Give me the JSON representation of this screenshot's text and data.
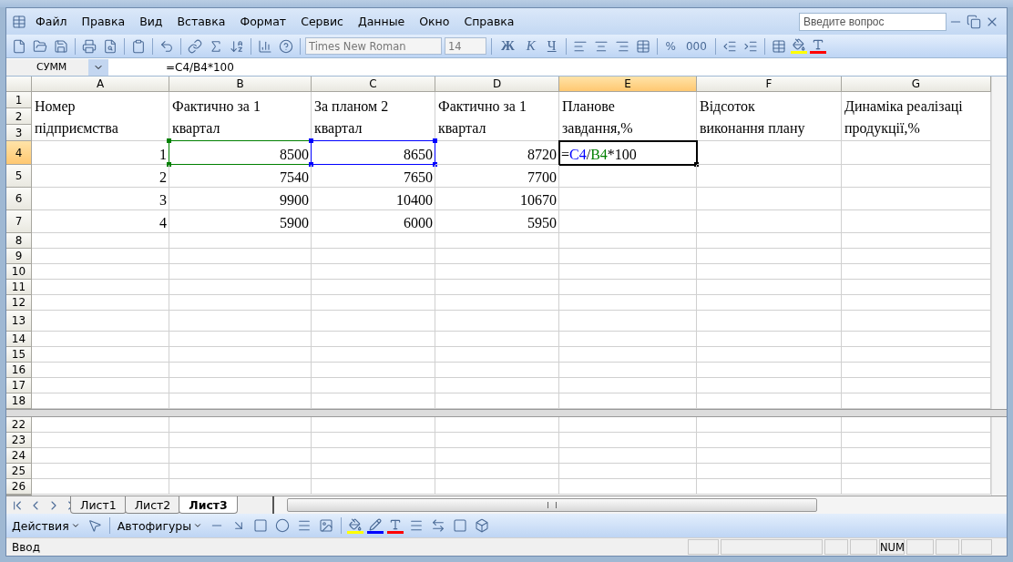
{
  "menu": [
    "Файл",
    "Правка",
    "Вид",
    "Вставка",
    "Формат",
    "Сервис",
    "Данные",
    "Окно",
    "Справка"
  ],
  "help": {
    "placeholder": "Введите вопрос"
  },
  "toolbar": {
    "font": "Times New Roman",
    "size": "14",
    "styles": [
      "Ж",
      "К",
      "Ч"
    ],
    "number_formats": [
      "%",
      "000"
    ]
  },
  "formula_bar": {
    "name_box": "СУММ",
    "formula": "=C4/B4*100"
  },
  "sheet": {
    "columns": [
      {
        "label": "A",
        "selected": false
      },
      {
        "label": "B",
        "selected": false
      },
      {
        "label": "C",
        "selected": false
      },
      {
        "label": "D",
        "selected": false
      },
      {
        "label": "E",
        "selected": true
      },
      {
        "label": "F",
        "selected": false
      },
      {
        "label": "G",
        "selected": false
      }
    ],
    "header_rows": [
      "1",
      "2",
      "3"
    ],
    "header_cells": [
      "Номер\nпідприємства",
      "Фактично за 1\nквартал",
      "За планом 2\nквартал",
      "Фактично за 1\nквартал",
      "Планове\nзавдання,%",
      "Відсоток\nвиконання плану",
      "Динаміка реалізаці\nпродукції,%"
    ],
    "rows": [
      {
        "number": "4",
        "selected": true,
        "cells": [
          {
            "text": "1"
          },
          {
            "text": "8500",
            "color": "#008000"
          },
          {
            "text": "8650",
            "color": "#0000ff"
          },
          {
            "text": "8720"
          },
          {
            "active": true,
            "parts": [
              {
                "text": "="
              },
              {
                "text": "C4",
                "color": "#0000ff"
              },
              {
                "text": "/"
              },
              {
                "text": "B4",
                "color": "#008000"
              },
              {
                "text": "*100"
              }
            ]
          }
        ]
      },
      {
        "number": "5",
        "selected": false,
        "cells": [
          {
            "text": "2"
          },
          {
            "text": "7540"
          },
          {
            "text": "7650"
          },
          {
            "text": "7700"
          }
        ]
      },
      {
        "number": "6",
        "selected": false,
        "cells": [
          {
            "text": "3"
          },
          {
            "text": "9900"
          },
          {
            "text": "10400"
          },
          {
            "text": "10670"
          }
        ]
      },
      {
        "number": "7",
        "selected": false,
        "cells": [
          {
            "text": "4"
          },
          {
            "text": "5900"
          },
          {
            "text": "6000"
          },
          {
            "text": "5950"
          }
        ]
      }
    ],
    "empty_rows": [
      "8",
      "9",
      "10",
      "11",
      "12",
      "13",
      "14",
      "15",
      "16",
      "17",
      "18"
    ],
    "lower_rows": [
      "22",
      "23",
      "24",
      "25",
      "26"
    ]
  },
  "sheet_tabs": [
    {
      "label": "Лист1",
      "selected": false
    },
    {
      "label": "Лист2",
      "selected": false
    },
    {
      "label": "Лист3",
      "selected": true
    }
  ],
  "drawing_toolbar": {
    "actions": "Действия",
    "autoshapes": "Автофигуры"
  },
  "status_bar": {
    "mode": "Ввод",
    "indicator": "NUM"
  }
}
